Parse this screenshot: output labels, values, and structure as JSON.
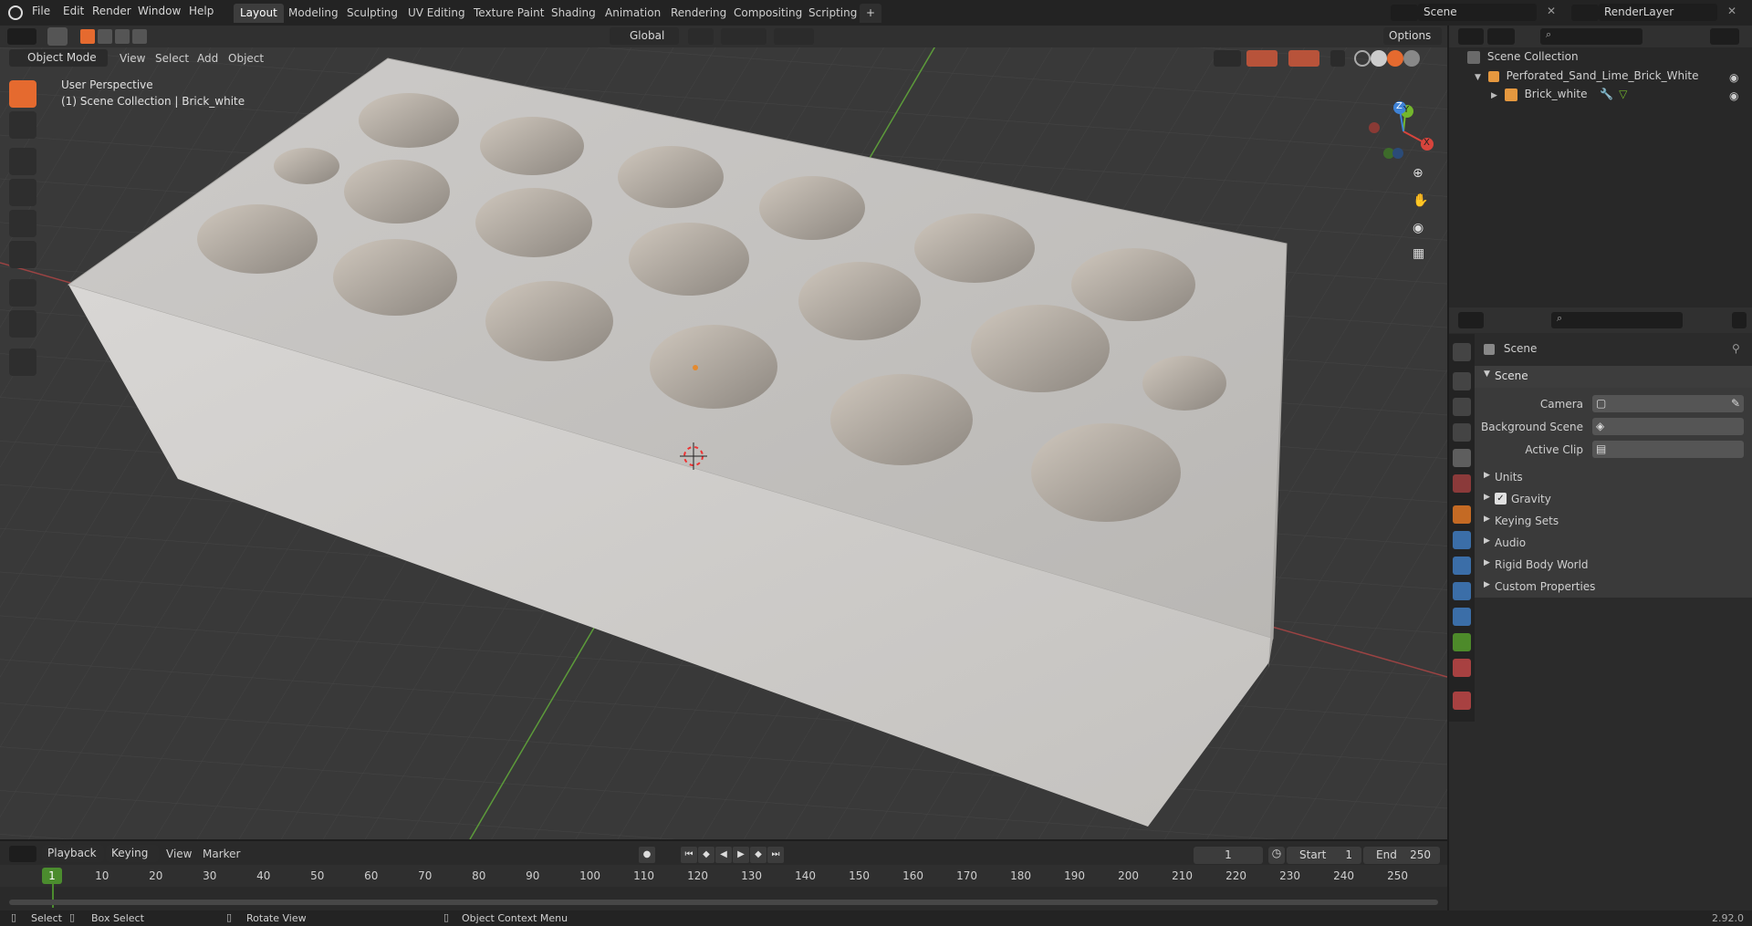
{
  "topbar": {
    "menus": [
      "File",
      "Edit",
      "Render",
      "Window",
      "Help"
    ],
    "tabs": [
      "Layout",
      "Modeling",
      "Sculpting",
      "UV Editing",
      "Texture Paint",
      "Shading",
      "Animation",
      "Rendering",
      "Compositing",
      "Scripting"
    ],
    "add_tab": "+",
    "scene_name": "Scene",
    "view_layer": "RenderLayer"
  },
  "viewport_header": {
    "mode": "Object Mode",
    "menus": [
      "View",
      "Select",
      "Add",
      "Object"
    ],
    "orientation": "Global",
    "options": "Options"
  },
  "viewport": {
    "perspective": "User Perspective",
    "collection_info": "(1) Scene Collection | Brick_white",
    "gizmo": {
      "x": "X",
      "y": "Y",
      "z": "Z"
    }
  },
  "outliner": {
    "root": "Scene Collection",
    "items": [
      {
        "label": "Perforated_Sand_Lime_Brick_White"
      },
      {
        "label": "Brick_white"
      }
    ]
  },
  "properties": {
    "header": "Scene",
    "panel": "Scene",
    "fields": [
      {
        "label": "Camera",
        "value": ""
      },
      {
        "label": "Background Scene",
        "value": ""
      },
      {
        "label": "Active Clip",
        "value": ""
      }
    ],
    "subpanels": [
      "Units",
      "Gravity",
      "Keying Sets",
      "Audio",
      "Rigid Body World",
      "Custom Properties"
    ],
    "gravity_checked": true
  },
  "timeline": {
    "menus": [
      "Playback",
      "Keying",
      "View",
      "Marker"
    ],
    "current_frame": "1",
    "start_label": "Start",
    "start": "1",
    "end_label": "End",
    "end": "250",
    "ticks": [
      "10",
      "20",
      "30",
      "40",
      "50",
      "60",
      "70",
      "80",
      "90",
      "100",
      "110",
      "120",
      "130",
      "140",
      "150",
      "160",
      "170",
      "180",
      "190",
      "200",
      "210",
      "220",
      "230",
      "240",
      "250"
    ],
    "playhead": "1"
  },
  "statusbar": {
    "select": "Select",
    "box_select": "Box Select",
    "rotate": "Rotate View",
    "context": "Object Context Menu",
    "version": "2.92.0"
  },
  "colors": {
    "accent": "#e56a2f",
    "x_axis": "#d8443c",
    "y_axis": "#73b62d",
    "z_axis": "#3e82d6"
  }
}
